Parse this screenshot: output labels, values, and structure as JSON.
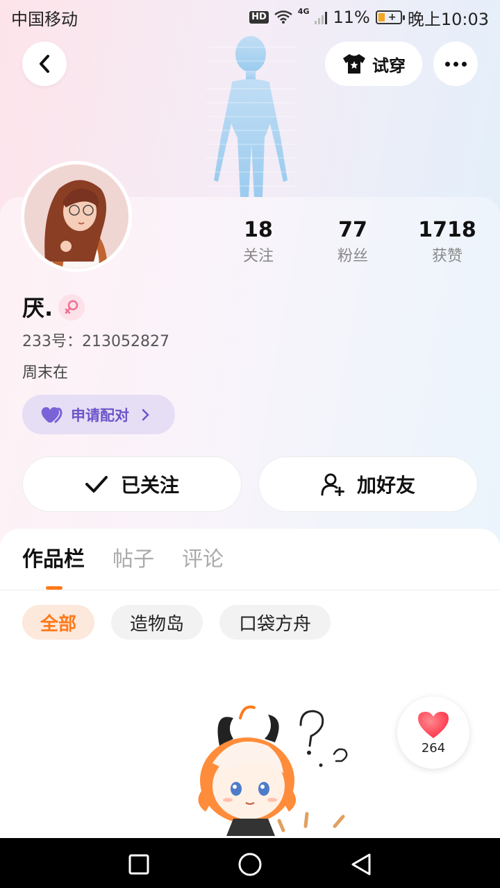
{
  "status_bar": {
    "carrier": "中国移动",
    "hd": "HD",
    "network": "4G",
    "battery": "11%",
    "time": "晚上10:03"
  },
  "header": {
    "try_on_label": "试穿"
  },
  "profile": {
    "stats": [
      {
        "value": "18",
        "label": "关注"
      },
      {
        "value": "77",
        "label": "粉丝"
      },
      {
        "value": "1718",
        "label": "获赞"
      }
    ],
    "username": "厌.",
    "uid": "233号：213052827",
    "bio": "周末在",
    "match_label": "申请配对",
    "follow_label": "已关注",
    "add_friend_label": "加好友"
  },
  "tabs": [
    {
      "label": "作品栏"
    },
    {
      "label": "帖子"
    },
    {
      "label": "评论"
    }
  ],
  "filters": [
    {
      "label": "全部"
    },
    {
      "label": "造物岛"
    },
    {
      "label": "口袋方舟"
    }
  ],
  "post": {
    "like_count": "264"
  },
  "colors": {
    "accent": "#ff7a1a",
    "match_purple": "#6a55c9",
    "heart_red": "#ff4d5a"
  },
  "icons": [
    "back-arrow-icon",
    "tshirt-icon",
    "more-dots-icon",
    "female-icon",
    "heart-pair-icon",
    "chevron-right-icon",
    "check-icon",
    "add-user-icon",
    "heart-icon",
    "square-icon",
    "circle-icon",
    "triangle-back-icon"
  ]
}
